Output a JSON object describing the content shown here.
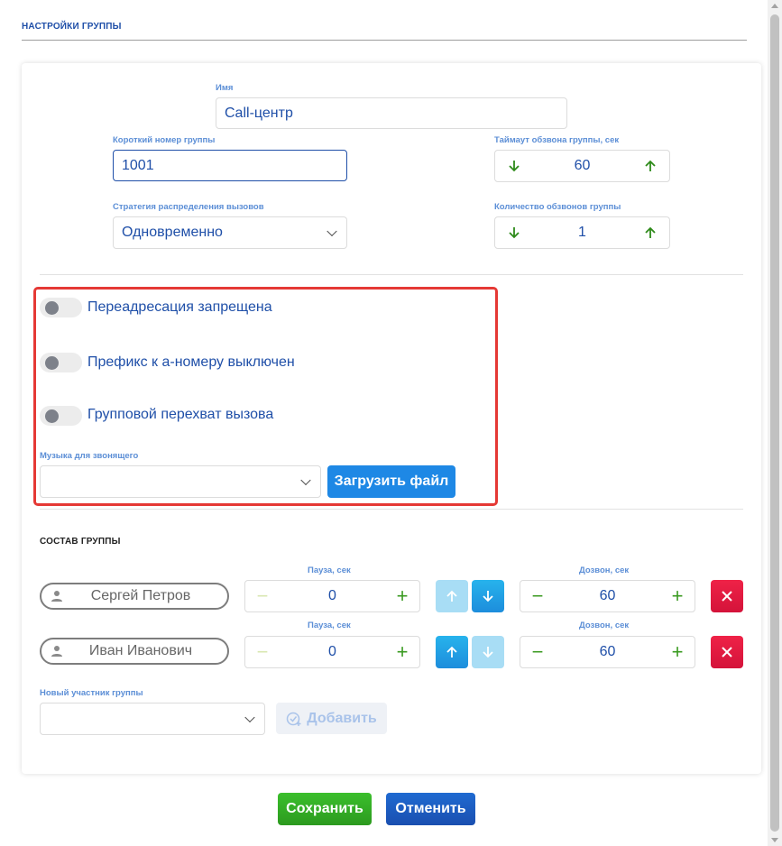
{
  "header": {
    "title": "НАСТРОЙКИ ГРУППЫ"
  },
  "form": {
    "name_label": "Имя",
    "name_value": "Call-центр",
    "short_number_label": "Короткий номер группы",
    "short_number_value": "1001",
    "timeout_label": "Таймаут обзвона группы, сек",
    "timeout_value": "60",
    "strategy_label": "Стратегия распределения вызовов",
    "strategy_value": "Одновременно",
    "rounds_label": "Количество обзвонов группы",
    "rounds_value": "1"
  },
  "toggles": [
    {
      "label": "Переадресация запрещена",
      "on": false
    },
    {
      "label": "Префикс к а-номеру выключен",
      "on": false
    },
    {
      "label": "Групповой перехват вызова",
      "on": false
    }
  ],
  "music": {
    "label": "Музыка для звонящего",
    "value": "",
    "upload_label": "Загрузить файл"
  },
  "members_section": {
    "title": "СОСТАВ ГРУППЫ",
    "pause_label": "Пауза, сек",
    "dial_label": "Дозвон, сек",
    "members": [
      {
        "name": "Сергей Петров",
        "pause": "0",
        "dial": "60"
      },
      {
        "name": "Иван Иванович",
        "pause": "0",
        "dial": "60"
      }
    ],
    "new_member_label": "Новый участник группы",
    "new_member_value": "",
    "add_label": "Добавить"
  },
  "footer": {
    "save_label": "Сохранить",
    "cancel_label": "Отменить"
  },
  "colors": {
    "accent": "#1f4fa8",
    "label": "#5b8ed6",
    "save": "#2c9a1f",
    "cancel": "#1a4fb0",
    "delete": "#e0173d",
    "highlight_box": "#e53935"
  }
}
